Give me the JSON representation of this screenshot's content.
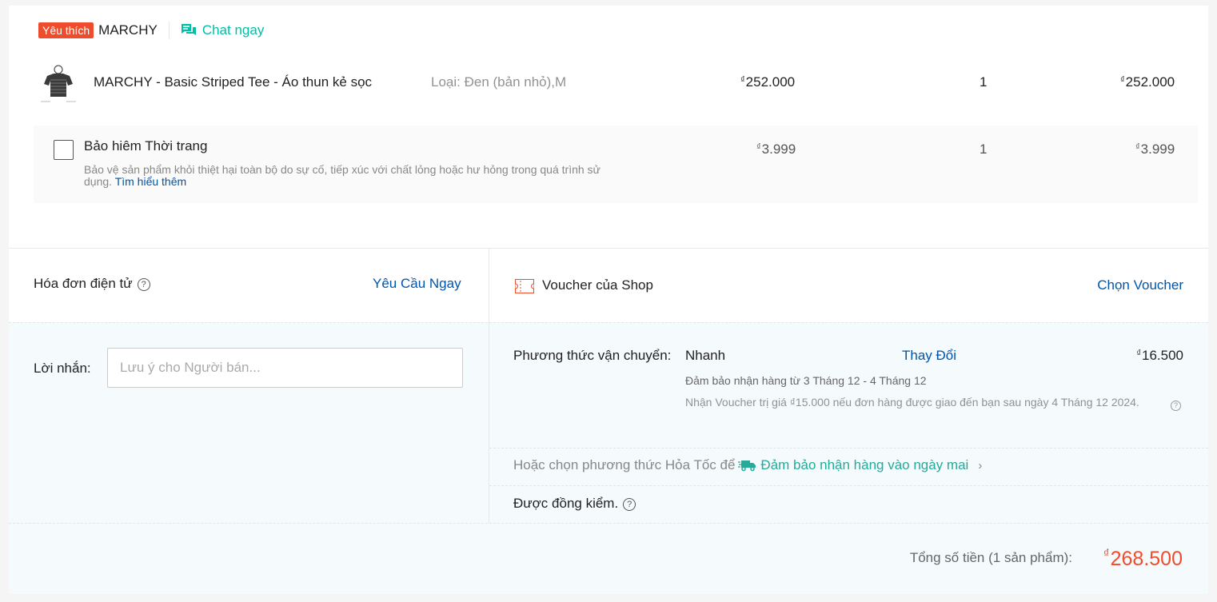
{
  "shop": {
    "badge": "Yêu thích",
    "name": "MARCHY",
    "chat_label": "Chat ngay"
  },
  "product": {
    "name": "MARCHY - Basic Striped Tee - Áo thun kẻ sọc",
    "variant": "Loại: Đen (bản nhỏ),M",
    "currency": "₫",
    "unit_price": "252.000",
    "quantity": "1",
    "subtotal": "252.000"
  },
  "insurance": {
    "title": "Bảo hiêm Thời trang",
    "description": "Bảo vệ sản phẩm khỏi thiệt hại toàn bộ do sự cố, tiếp xúc với chất lỏng hoặc hư hỏng trong quá trình sử dụng.",
    "learn_more": "Tìm hiểu thêm",
    "currency": "₫",
    "unit_price": "3.999",
    "quantity": "1",
    "subtotal": "3.999",
    "checked": false
  },
  "invoice": {
    "label": "Hóa đơn điện tử",
    "action": "Yêu Cầu Ngay"
  },
  "voucher": {
    "label": "Voucher của Shop",
    "action": "Chọn Voucher"
  },
  "message": {
    "label": "Lời nhắn:",
    "placeholder": "Lưu ý cho Người bán..."
  },
  "shipping": {
    "label": "Phương thức vận chuyển:",
    "method": "Nhanh",
    "change": "Thay Đổi",
    "currency": "₫",
    "price": "16.500",
    "guarantee": "Đảm bảo nhận hàng từ 3 Tháng 12 - 4 Tháng 12",
    "voucher_note": "Nhận Voucher trị giá ₫15.000 nếu đơn hàng được giao đến bạn sau ngày 4 Tháng 12 2024."
  },
  "express": {
    "prefix": "Hoặc chọn phương thức Hỏa Tốc để",
    "link": "Đảm bảo nhận hàng vào ngày mai"
  },
  "cod_check": {
    "label": "Được đồng kiểm."
  },
  "total": {
    "label": "Tổng số tiền (1 sản phẩm):",
    "currency": "₫",
    "value": "268.500"
  },
  "colors": {
    "accent": "#ee4d2d",
    "chat": "#00bfa5",
    "link": "#0055aa",
    "express_green": "#26aa99"
  }
}
